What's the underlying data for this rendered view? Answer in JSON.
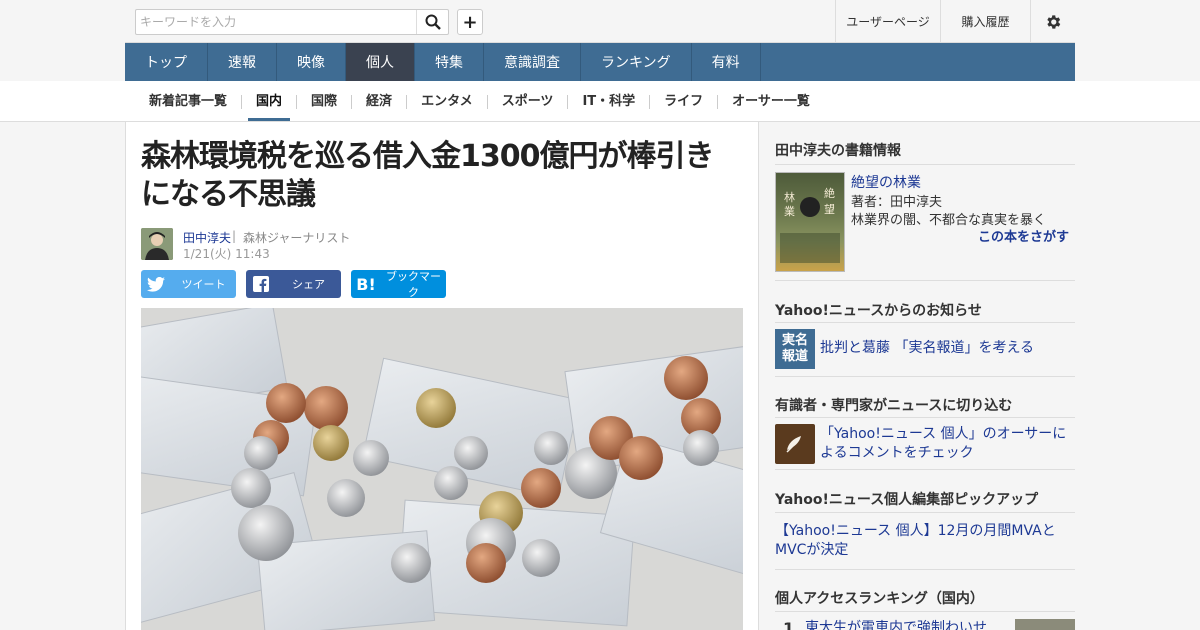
{
  "header": {
    "search_placeholder": "キーワードを入力",
    "user_page": "ユーザーページ",
    "history": "購入履歴"
  },
  "nav": [
    "トップ",
    "速報",
    "映像",
    "個人",
    "特集",
    "意識調査",
    "ランキング",
    "有料"
  ],
  "nav_active": "個人",
  "subnav": [
    "新着記事一覧",
    "国内",
    "国際",
    "経済",
    "エンタメ",
    "スポーツ",
    "IT・科学",
    "ライフ",
    "オーサー一覧"
  ],
  "subnav_active": "国内",
  "article": {
    "title": "森林環境税を巡る借入金1300億円が棒引きになる不思議",
    "author": "田中淳夫",
    "author_sep": "|",
    "author_title": "森林ジャーナリスト",
    "date": "1/21(火) 11:43",
    "share_tweet": "ツイート",
    "share_fb": "シェア",
    "share_hb": "ブックマーク",
    "hb_icon": "B!"
  },
  "sidebar": {
    "books_heading": "田中淳夫の書籍情報",
    "book_title": "絶望の林業",
    "book_author": "著者：田中淳夫",
    "book_desc": "林業界の闇、不都合な真実を暴く",
    "book_more": "この本をさがす",
    "notice_heading": "Yahoo!ニュースからのお知らせ",
    "notice_badge_1": "実名",
    "notice_badge_2": "報道",
    "notice_link": "批判と葛藤 「実名報道」を考える",
    "expert_heading": "有識者・専門家がニュースに切り込む",
    "expert_link": "「Yahoo!ニュース 個人」のオーサーによるコメントをチェック",
    "pickup_heading": "Yahoo!ニュース個人編集部ピックアップ",
    "pickup_link": "【Yahoo!ニュース 個人】12月の月間MVAとMVCが決定",
    "ranking_heading": "個人アクセスランキング（国内）",
    "ranking_1_num": "1",
    "ranking_1_text": "東大生が電車内で強制わいせ"
  }
}
